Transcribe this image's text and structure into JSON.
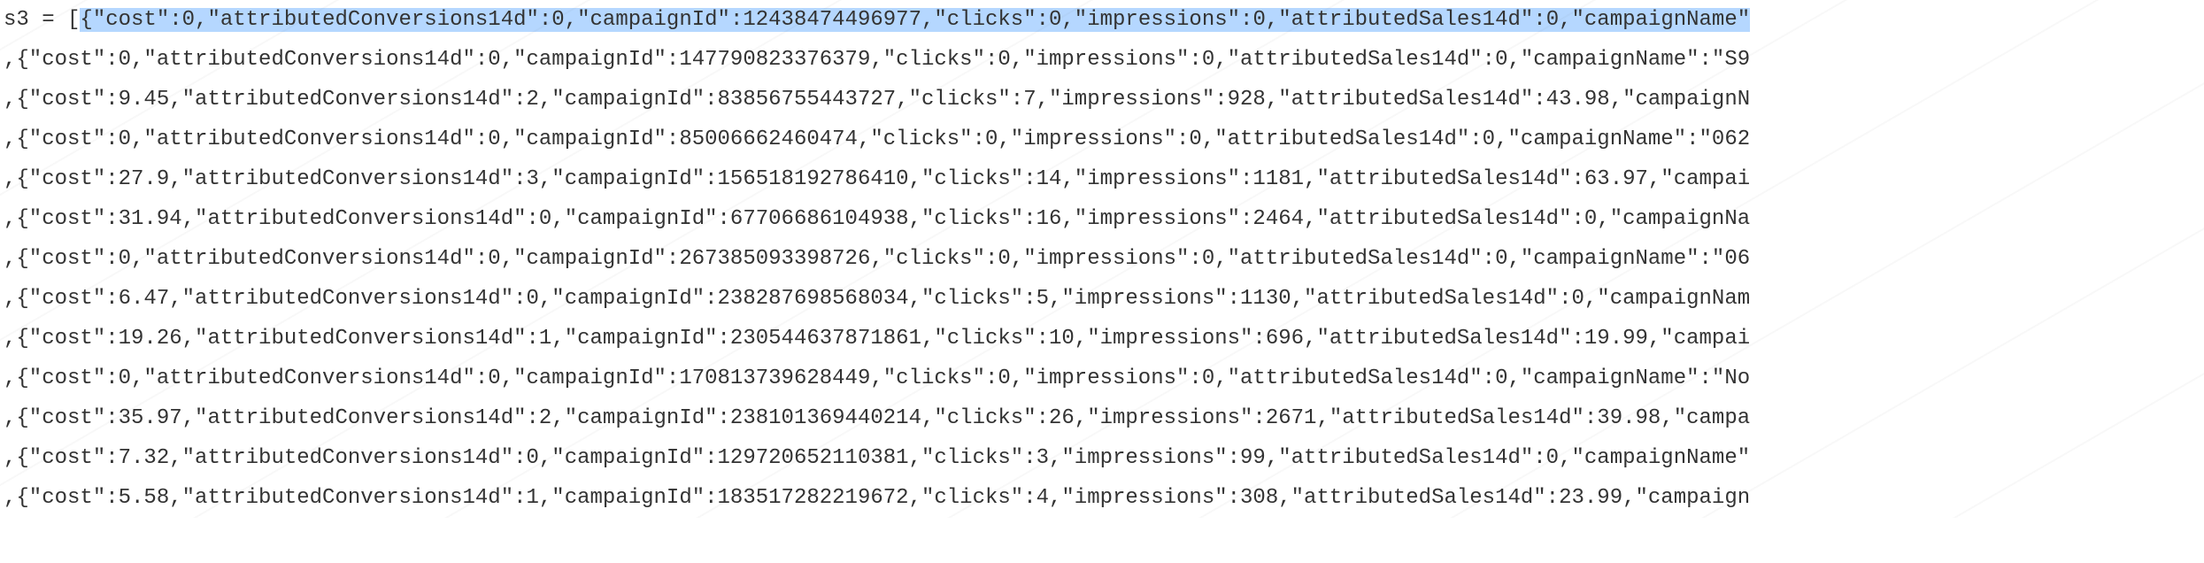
{
  "code": {
    "prefix": "s3 = [",
    "lines": [
      "{\"cost\":0,\"attributedConversions14d\":0,\"campaignId\":12438474496977,\"clicks\":0,\"impressions\":0,\"attributedSales14d\":0,\"campaignName\"",
      ",{\"cost\":0,\"attributedConversions14d\":0,\"campaignId\":147790823376379,\"clicks\":0,\"impressions\":0,\"attributedSales14d\":0,\"campaignName\":\"S9",
      ",{\"cost\":9.45,\"attributedConversions14d\":2,\"campaignId\":83856755443727,\"clicks\":7,\"impressions\":928,\"attributedSales14d\":43.98,\"campaignN",
      ",{\"cost\":0,\"attributedConversions14d\":0,\"campaignId\":85006662460474,\"clicks\":0,\"impressions\":0,\"attributedSales14d\":0,\"campaignName\":\"062",
      ",{\"cost\":27.9,\"attributedConversions14d\":3,\"campaignId\":156518192786410,\"clicks\":14,\"impressions\":1181,\"attributedSales14d\":63.97,\"campai",
      ",{\"cost\":31.94,\"attributedConversions14d\":0,\"campaignId\":67706686104938,\"clicks\":16,\"impressions\":2464,\"attributedSales14d\":0,\"campaignNa",
      ",{\"cost\":0,\"attributedConversions14d\":0,\"campaignId\":267385093398726,\"clicks\":0,\"impressions\":0,\"attributedSales14d\":0,\"campaignName\":\"06",
      ",{\"cost\":6.47,\"attributedConversions14d\":0,\"campaignId\":238287698568034,\"clicks\":5,\"impressions\":1130,\"attributedSales14d\":0,\"campaignNam",
      ",{\"cost\":19.26,\"attributedConversions14d\":1,\"campaignId\":230544637871861,\"clicks\":10,\"impressions\":696,\"attributedSales14d\":19.99,\"campai",
      ",{\"cost\":0,\"attributedConversions14d\":0,\"campaignId\":170813739628449,\"clicks\":0,\"impressions\":0,\"attributedSales14d\":0,\"campaignName\":\"No",
      ",{\"cost\":35.97,\"attributedConversions14d\":2,\"campaignId\":238101369440214,\"clicks\":26,\"impressions\":2671,\"attributedSales14d\":39.98,\"campa",
      ",{\"cost\":7.32,\"attributedConversions14d\":0,\"campaignId\":129720652110381,\"clicks\":3,\"impressions\":99,\"attributedSales14d\":0,\"campaignName\"",
      ",{\"cost\":5.58,\"attributedConversions14d\":1,\"campaignId\":183517282219672,\"clicks\":4,\"impressions\":308,\"attributedSales14d\":23.99,\"campaign"
    ]
  }
}
